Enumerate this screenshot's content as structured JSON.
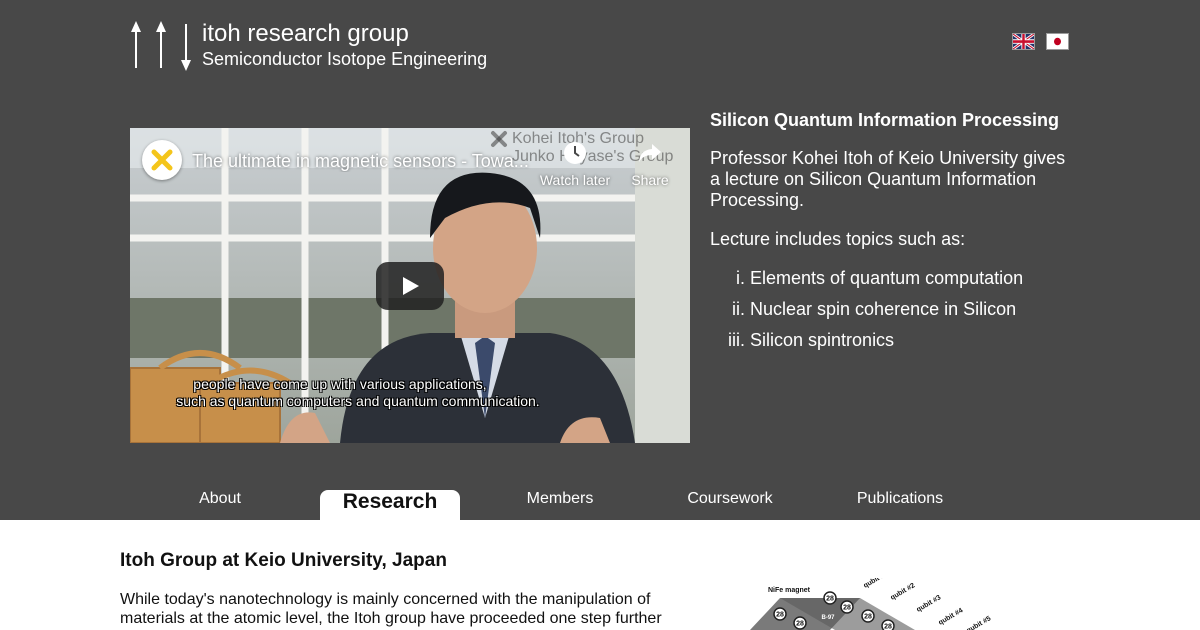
{
  "header": {
    "title": "itoh research group",
    "subtitle": "Semiconductor Isotope Engineering",
    "logo_icon": "spin-arrows-icon",
    "languages": [
      "english-flag-icon",
      "japanese-flag-icon"
    ]
  },
  "video": {
    "title": "The ultimate in magnetic sensors - Towa...",
    "watermark_line1": "Kohei Itoh's Group",
    "watermark_line2": "Junko Hayase's Group",
    "watch_later_label": "Watch later",
    "share_label": "Share",
    "subtitle_line1": "people have come up with various applications,",
    "subtitle_line2": "such as quantum computers and quantum communication."
  },
  "side": {
    "heading": "Silicon Quantum Information Processing",
    "intro": "Professor Kohei Itoh of Keio University gives a lecture on Silicon Quantum Information Processing.",
    "topics_lead": "Lecture includes topics such as:",
    "topics": [
      {
        "num": "i.",
        "text": "Elements of quantum computation"
      },
      {
        "num": "ii.",
        "text": "Nuclear spin coherence in Silicon"
      },
      {
        "num": "iii.",
        "text": "Silicon spintronics"
      }
    ]
  },
  "nav": {
    "items": [
      "About",
      "Research",
      "Members",
      "Coursework",
      "Publications"
    ],
    "active": "Research"
  },
  "main": {
    "heading": "Itoh Group at Keio University, Japan",
    "text": "While today's nanotechnology is mainly concerned with the manipulation of materials at the atomic level, the Itoh group have proceeded one step further"
  },
  "figure": {
    "magnet_label": "NiFe magnet",
    "qubit_labels": [
      "qubit #1",
      "qubit #2",
      "qubit #3",
      "qubit #4",
      "qubit #5"
    ],
    "isotope_label": "28",
    "field_label": "B-97"
  },
  "colors": {
    "header_bg": "#484848",
    "text_light": "#ffffff",
    "text_dark": "#111111"
  }
}
